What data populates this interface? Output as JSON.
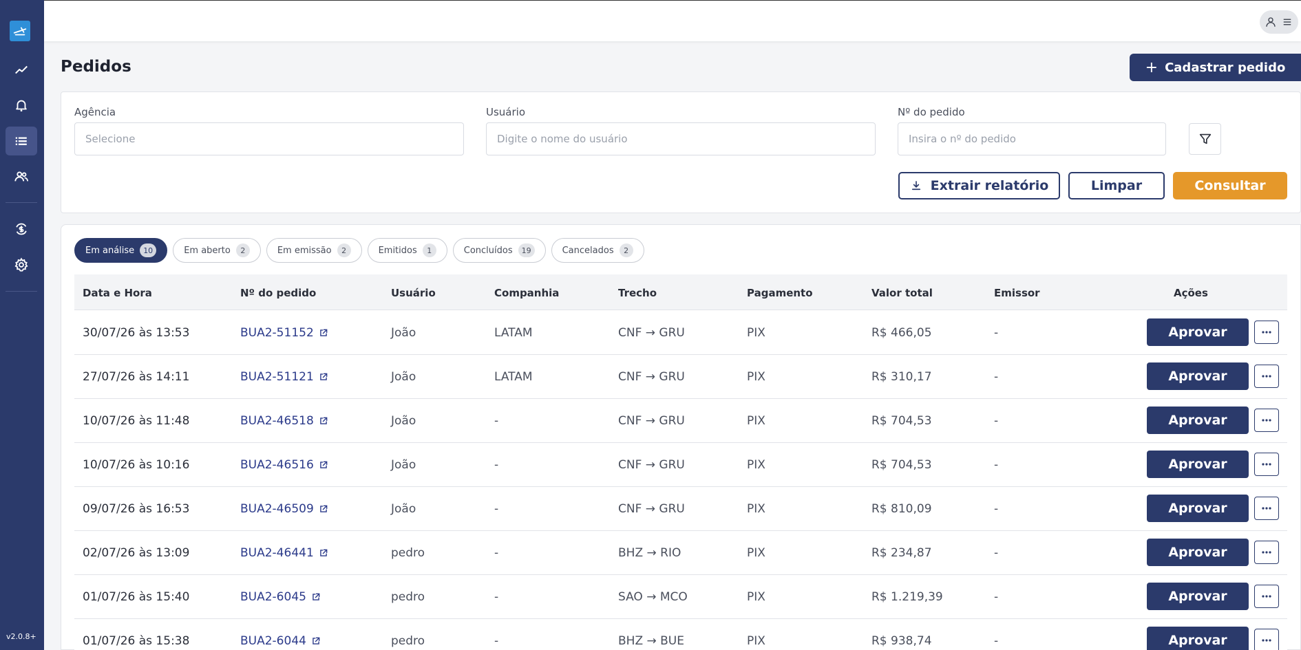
{
  "sidebar": {
    "version": "v2.0.8+",
    "items": [
      {
        "icon": "chart-line-icon"
      },
      {
        "icon": "bell-icon"
      },
      {
        "icon": "list-icon",
        "active": true
      },
      {
        "icon": "users-icon"
      },
      {
        "icon": "currency-exchange-icon"
      },
      {
        "icon": "gear-icon"
      }
    ]
  },
  "header": {
    "title": "Pedidos",
    "create_label": "Cadastrar pedido"
  },
  "filters": {
    "agency_label": "Agência",
    "agency_placeholder": "Selecione",
    "user_label": "Usuário",
    "user_placeholder": "Digite o nome do usuário",
    "order_label": "Nº do pedido",
    "order_placeholder": "Insira o nº do pedido",
    "extract_label": "Extrair relatório",
    "clear_label": "Limpar",
    "search_label": "Consultar"
  },
  "tabs": [
    {
      "label": "Em análise",
      "count": "10",
      "active": true
    },
    {
      "label": "Em aberto",
      "count": "2"
    },
    {
      "label": "Em emissão",
      "count": "2"
    },
    {
      "label": "Emitidos",
      "count": "1"
    },
    {
      "label": "Concluídos",
      "count": "19"
    },
    {
      "label": "Cancelados",
      "count": "2"
    }
  ],
  "table": {
    "headers": {
      "date": "Data e Hora",
      "order": "Nº do pedido",
      "user": "Usuário",
      "company": "Companhia",
      "route": "Trecho",
      "payment": "Pagamento",
      "total": "Valor total",
      "issuer": "Emissor",
      "actions": "Ações"
    },
    "approve_label": "Aprovar",
    "rows": [
      {
        "date": "30/07/26 às 13:53",
        "order": "BUA2-51152",
        "user": "João",
        "company": "LATAM",
        "route": "CNF → GRU",
        "payment": "PIX",
        "total": "R$ 466,05",
        "issuer": "-"
      },
      {
        "date": "27/07/26 às 14:11",
        "order": "BUA2-51121",
        "user": "João",
        "company": "LATAM",
        "route": "CNF → GRU",
        "payment": "PIX",
        "total": "R$ 310,17",
        "issuer": "-"
      },
      {
        "date": "10/07/26 às 11:48",
        "order": "BUA2-46518",
        "user": "João",
        "company": "-",
        "route": "CNF → GRU",
        "payment": "PIX",
        "total": "R$ 704,53",
        "issuer": "-"
      },
      {
        "date": "10/07/26 às 10:16",
        "order": "BUA2-46516",
        "user": "João",
        "company": "-",
        "route": "CNF → GRU",
        "payment": "PIX",
        "total": "R$ 704,53",
        "issuer": "-"
      },
      {
        "date": "09/07/26 às 16:53",
        "order": "BUA2-46509",
        "user": "João",
        "company": "-",
        "route": "CNF → GRU",
        "payment": "PIX",
        "total": "R$ 810,09",
        "issuer": "-"
      },
      {
        "date": "02/07/26 às 13:09",
        "order": "BUA2-46441",
        "user": "pedro",
        "company": "-",
        "route": "BHZ → RIO",
        "payment": "PIX",
        "total": "R$ 234,87",
        "issuer": "-"
      },
      {
        "date": "01/07/26 às 15:40",
        "order": "BUA2-6045",
        "user": "pedro",
        "company": "-",
        "route": "SAO → MCO",
        "payment": "PIX",
        "total": "R$ 1.219,39",
        "issuer": "-"
      },
      {
        "date": "01/07/26 às 15:38",
        "order": "BUA2-6044",
        "user": "pedro",
        "company": "-",
        "route": "BHZ → BUE",
        "payment": "PIX",
        "total": "R$ 938,74",
        "issuer": "-"
      }
    ]
  },
  "colors": {
    "primary": "#2b3a6b",
    "accent": "#e5982a"
  }
}
